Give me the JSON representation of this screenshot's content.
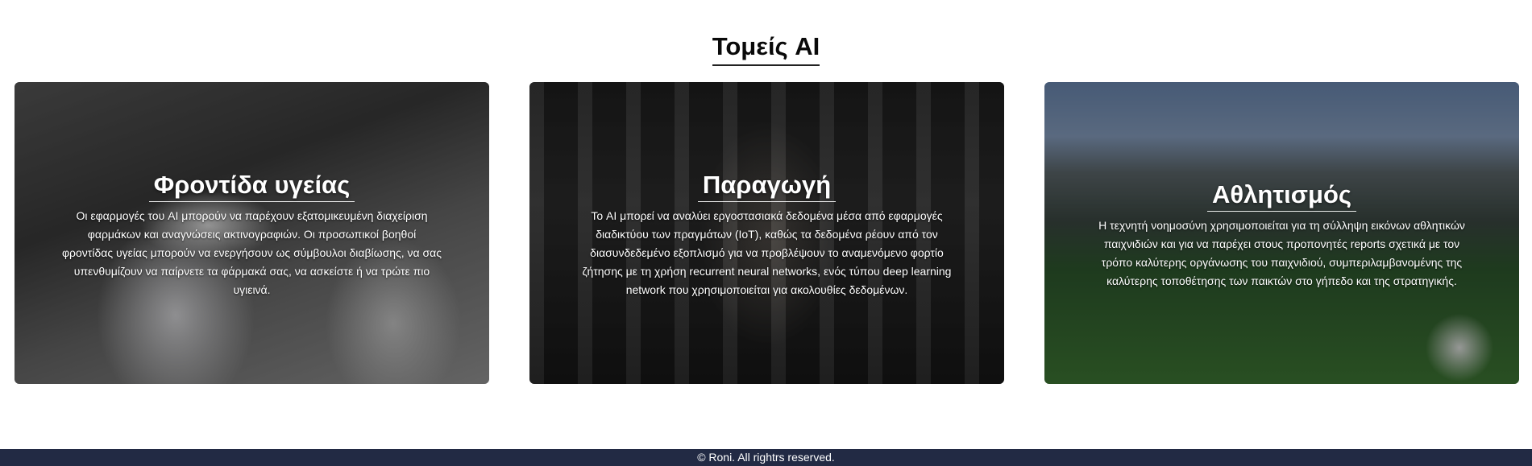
{
  "section": {
    "title": "Τομείς AI"
  },
  "cards": [
    {
      "title": "Φροντίδα υγείας",
      "text": "Οι εφαρμογές του AI μπορούν να παρέχουν εξατομικευμένη διαχείριση φαρμάκων και αναγνώσεις ακτινογραφιών. Οι προσωπικοί βοηθοί φροντίδας υγείας μπορούν να ενεργήσουν ως σύμβουλοι διαβίωσης, να σας υπενθυμίζουν να παίρνετε τα φάρμακά σας, να ασκείστε ή να τρώτε πιο υγιεινά."
    },
    {
      "title": "Παραγωγή",
      "text": "Το AI μπορεί να αναλύει εργοστασιακά δεδομένα μέσα από εφαρμογές διαδικτύου των πραγμάτων (IoT), καθώς τα δεδομένα ρέουν από τον διασυνδεδεμένο εξοπλισμό για να προβλέψουν το αναμενόμενο φορτίο ζήτησης με τη χρήση recurrent neural networks, ενός τύπου deep learning network που χρησιμοποιείται για ακολουθίες δεδομένων."
    },
    {
      "title": "Αθλητισμός",
      "text": "Η τεχνητή νοημοσύνη χρησιμοποιείται για τη σύλληψη εικόνων αθλητικών παιχνιδιών και για να παρέχει στους προπονητές reports σχετικά με τον τρόπο καλύτερης οργάνωσης του παιχνιδιού, συμπεριλαμβανομένης της καλύτερης τοποθέτησης των παικτών στο γήπεδο και της στρατηγικής."
    }
  ],
  "footer": {
    "text": "© Roni. All rightrs reserved."
  }
}
